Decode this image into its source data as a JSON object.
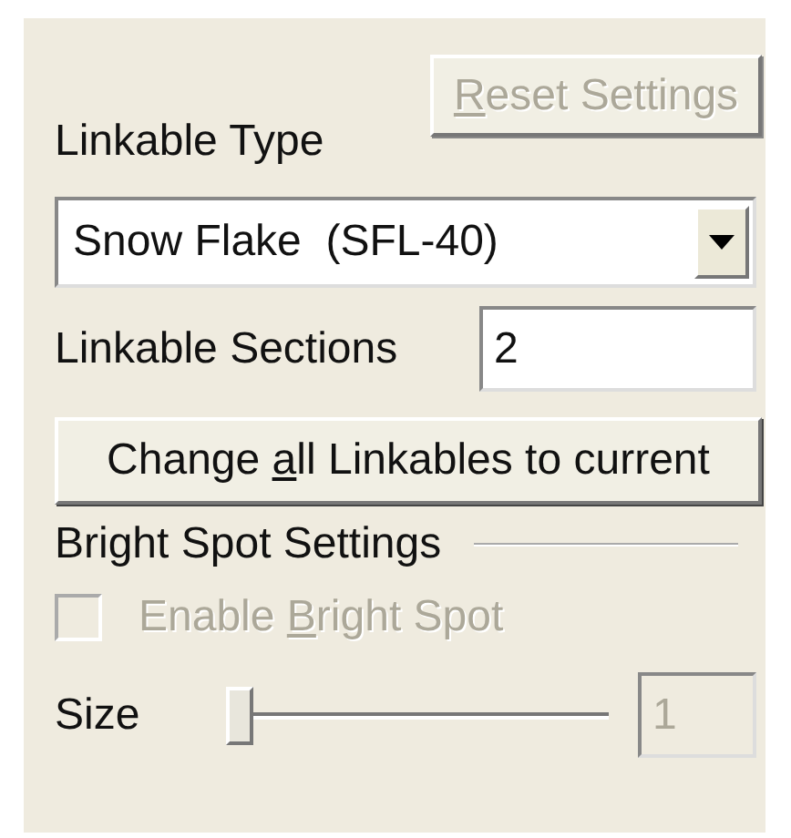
{
  "reset_button": {
    "label": [
      {
        "text": "R",
        "underline": true
      },
      {
        "text": "eset Settings",
        "underline": false
      }
    ],
    "disabled": true
  },
  "linkable_type": {
    "label": "Linkable Type",
    "value": "Snow Flake  (SFL-40)"
  },
  "linkable_sections": {
    "label": "Linkable Sections",
    "value": "2"
  },
  "change_button": {
    "label": [
      {
        "text": "Change ",
        "underline": false
      },
      {
        "text": "a",
        "underline": true
      },
      {
        "text": "ll Linkables to current",
        "underline": false
      }
    ],
    "disabled": false
  },
  "bright_spot": {
    "heading": "Bright Spot Settings",
    "enable": {
      "label": [
        {
          "text": "Enable ",
          "underline": false
        },
        {
          "text": "B",
          "underline": true
        },
        {
          "text": "right Spot",
          "underline": false
        }
      ],
      "checked": false,
      "disabled": true
    },
    "size": {
      "label": "Size",
      "level": 0,
      "value": "1",
      "disabled": true
    }
  }
}
